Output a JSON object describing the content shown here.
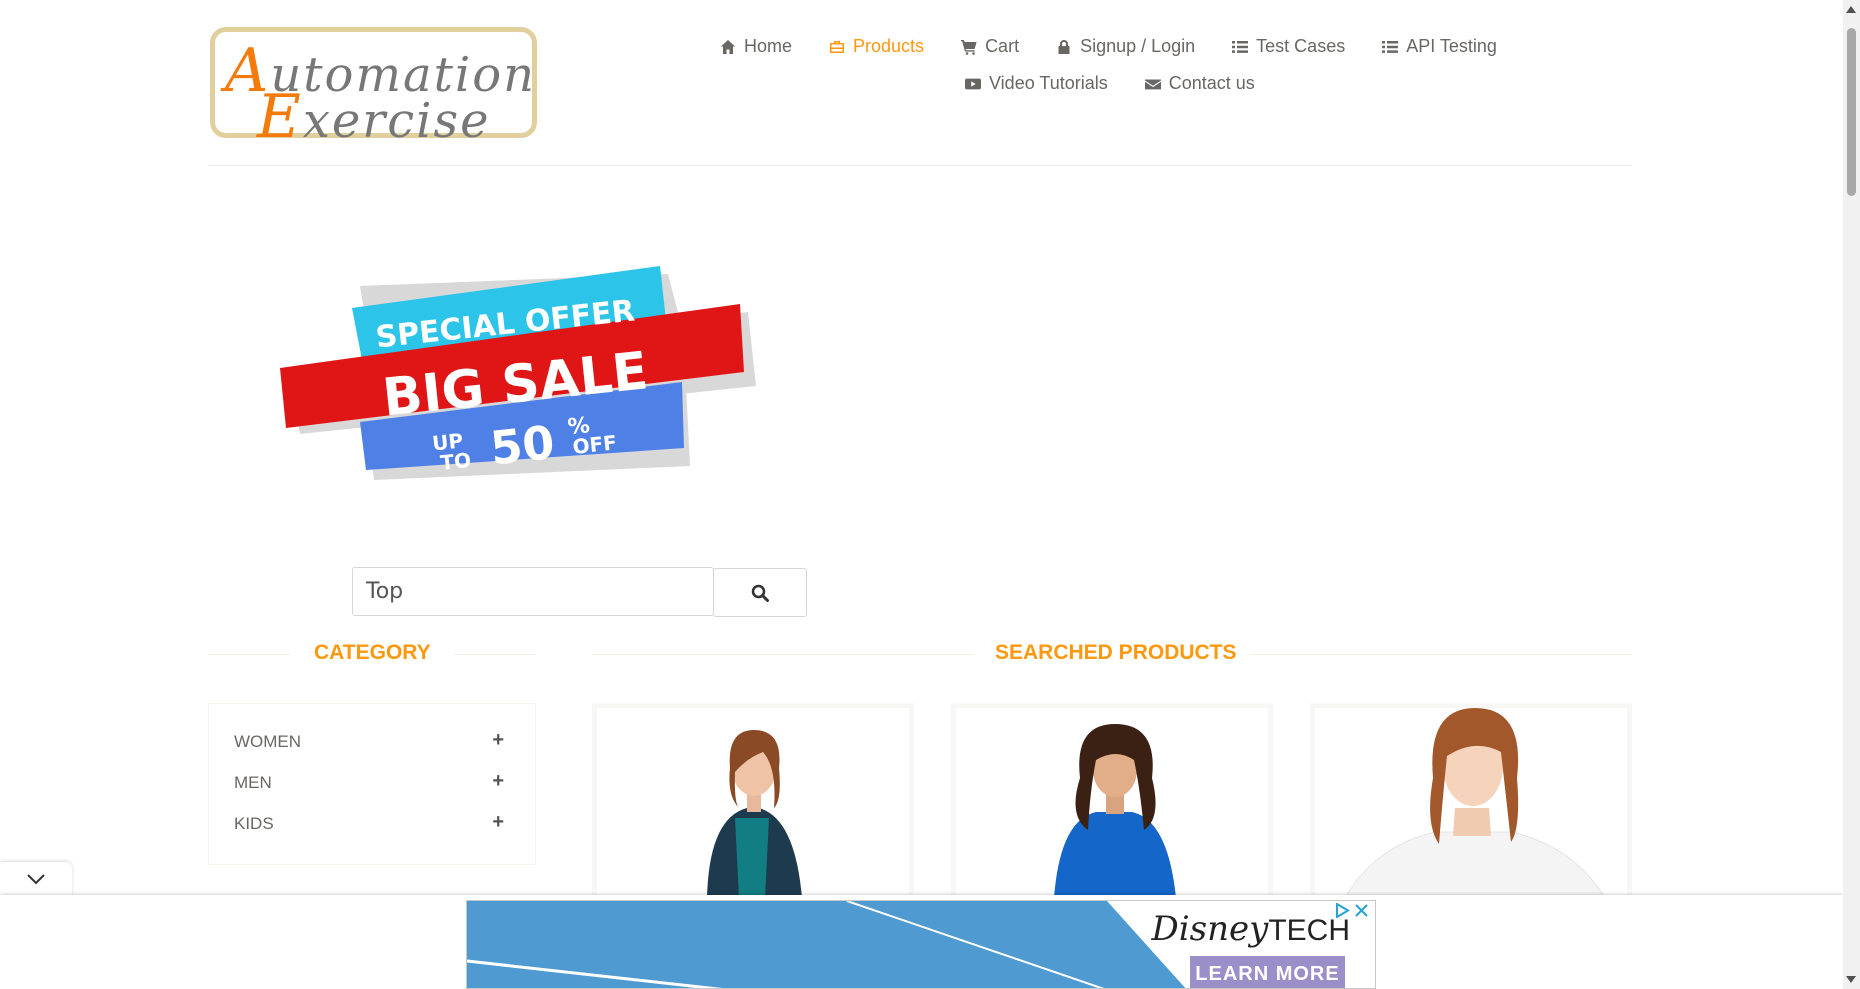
{
  "logo": {
    "line1_cap": "A",
    "line1_rest": "utomation",
    "line2_cap": "E",
    "line2_rest": "xercise"
  },
  "nav": {
    "row1": [
      {
        "icon": "home-icon",
        "label": "Home",
        "active": false
      },
      {
        "icon": "briefcase-icon",
        "label": "Products",
        "active": true
      },
      {
        "icon": "cart-icon",
        "label": "Cart",
        "active": false
      },
      {
        "icon": "lock-icon",
        "label": "Signup / Login",
        "active": false
      },
      {
        "icon": "list-icon",
        "label": "Test Cases",
        "active": false
      },
      {
        "icon": "list-icon",
        "label": "API Testing",
        "active": false
      }
    ],
    "row2": [
      {
        "icon": "youtube-icon",
        "label": "Video Tutorials",
        "active": false
      },
      {
        "icon": "envelope-icon",
        "label": "Contact us",
        "active": false
      }
    ]
  },
  "banner": {
    "line1": "SPECIAL OFFER",
    "line2": "BIG SALE",
    "up": "UP",
    "to": "TO",
    "amount": "50",
    "percent": "%",
    "off": "OFF"
  },
  "search": {
    "value": "Top",
    "icon": "search-icon"
  },
  "sections": {
    "category": "CATEGORY",
    "products": "SEARCHED PRODUCTS"
  },
  "categories": [
    {
      "label": "WOMEN",
      "icon": "plus-icon"
    },
    {
      "label": "MEN",
      "icon": "plus-icon"
    },
    {
      "label": "KIDS",
      "icon": "plus-icon"
    }
  ],
  "ad": {
    "brand": "Disney",
    "brand_suffix": "TECH",
    "cta": "LEARN MORE",
    "icons": [
      "adchoices-icon",
      "close-icon"
    ]
  },
  "colors": {
    "accent": "#fe980f",
    "text": "#696763",
    "logo_orange": "#f47a0b"
  }
}
